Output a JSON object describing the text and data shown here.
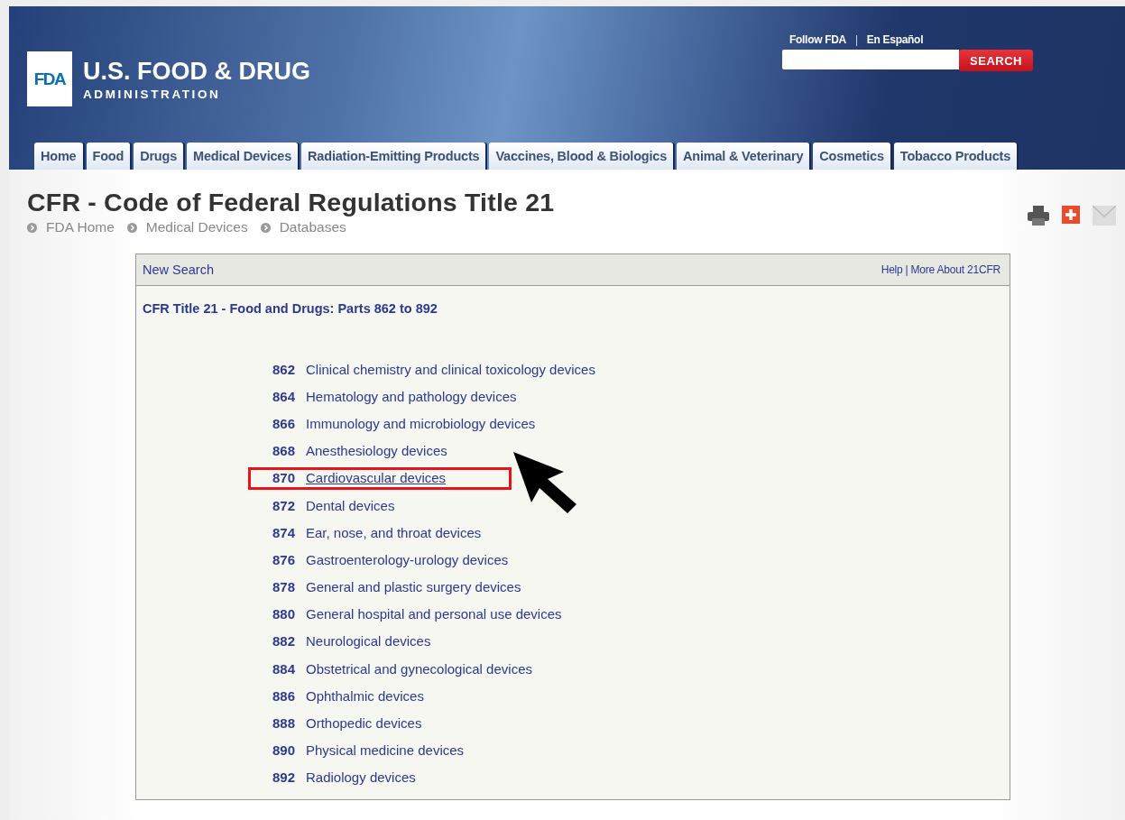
{
  "header": {
    "logo_mark": "FDA",
    "logo_title": "U.S. FOOD & DRUG",
    "logo_subtitle": "ADMINISTRATION",
    "top_links": [
      "Follow FDA",
      "En Español"
    ],
    "link_separator": "|",
    "search_button": "SEARCH"
  },
  "nav_tabs": [
    "Home",
    "Food",
    "Drugs",
    "Medical Devices",
    "Radiation-Emitting Products",
    "Vaccines, Blood & Biologics",
    "Animal & Veterinary",
    "Cosmetics",
    "Tobacco Products"
  ],
  "page_title": "CFR - Code of Federal Regulations Title 21",
  "breadcrumb": [
    "FDA Home",
    "Medical Devices",
    "Databases"
  ],
  "panel": {
    "new_search": "New Search",
    "help_links": [
      "Help",
      "More About 21CFR"
    ],
    "help_separator": "|",
    "heading": "CFR Title 21 - Food and Drugs: Parts 862 to 892",
    "parts": [
      {
        "number": "862",
        "title": "Clinical chemistry and clinical toxicology devices",
        "highlighted": false
      },
      {
        "number": "864",
        "title": "Hematology and pathology devices",
        "highlighted": false
      },
      {
        "number": "866",
        "title": "Immunology and microbiology devices",
        "highlighted": false
      },
      {
        "number": "868",
        "title": "Anesthesiology devices",
        "highlighted": false
      },
      {
        "number": "870",
        "title": "Cardiovascular devices",
        "highlighted": true
      },
      {
        "number": "872",
        "title": "Dental devices",
        "highlighted": false
      },
      {
        "number": "874",
        "title": "Ear, nose, and throat devices",
        "highlighted": false
      },
      {
        "number": "876",
        "title": "Gastroenterology-urology devices",
        "highlighted": false
      },
      {
        "number": "878",
        "title": "General and plastic surgery devices",
        "highlighted": false
      },
      {
        "number": "880",
        "title": "General hospital and personal use devices",
        "highlighted": false
      },
      {
        "number": "882",
        "title": "Neurological devices",
        "highlighted": false
      },
      {
        "number": "884",
        "title": "Obstetrical and gynecological devices",
        "highlighted": false
      },
      {
        "number": "886",
        "title": "Ophthalmic devices",
        "highlighted": false
      },
      {
        "number": "888",
        "title": "Orthopedic devices",
        "highlighted": false
      },
      {
        "number": "890",
        "title": "Physical medicine devices",
        "highlighted": false
      },
      {
        "number": "892",
        "title": "Radiology devices",
        "highlighted": false
      }
    ]
  }
}
